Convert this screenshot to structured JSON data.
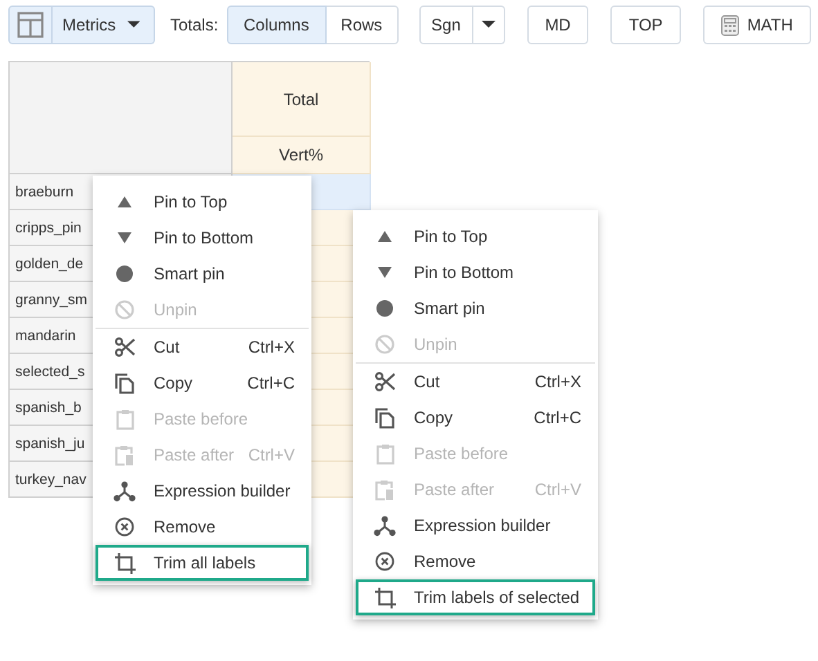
{
  "toolbar": {
    "layout_button": {
      "selected": true
    },
    "metrics": {
      "label": "Metrics",
      "selected": true
    },
    "totals_label": "Totals:",
    "totals": [
      {
        "label": "Columns",
        "selected": true
      },
      {
        "label": "Rows",
        "selected": false
      }
    ],
    "sgn": "Sgn",
    "buttons": [
      {
        "label": "MD",
        "kind": "plain"
      },
      {
        "label": "TOP",
        "kind": "plain"
      },
      {
        "label": "MATH",
        "kind": "calc"
      }
    ]
  },
  "table": {
    "column": "Total",
    "measure": "Vert%",
    "rows": [
      {
        "label": "braeburn",
        "selected": true
      },
      {
        "label": "cripps_pin",
        "selected": false
      },
      {
        "label": "golden_de",
        "selected": false
      },
      {
        "label": "granny_sm",
        "selected": false
      },
      {
        "label": "mandarin",
        "selected": false
      },
      {
        "label": "selected_s",
        "selected": false
      },
      {
        "label": "spanish_b",
        "selected": false
      },
      {
        "label": "spanish_ju",
        "selected": false
      },
      {
        "label": "turkey_nav",
        "selected": false
      }
    ]
  },
  "menus": [
    {
      "groups": [
        [
          {
            "kind": "pintop",
            "label": "Pin to Top",
            "disabled": false,
            "highlighted": false
          },
          {
            "kind": "pinbottom",
            "label": "Pin to Bottom",
            "disabled": false,
            "highlighted": false
          },
          {
            "kind": "smartpin",
            "label": "Smart pin",
            "disabled": false,
            "highlighted": false
          },
          {
            "kind": "unpin",
            "label": "Unpin",
            "disabled": true,
            "highlighted": false
          }
        ],
        [
          {
            "kind": "cut",
            "label": "Cut",
            "shortcut": "Ctrl+X",
            "disabled": false,
            "highlighted": false
          },
          {
            "kind": "copy",
            "label": "Copy",
            "shortcut": "Ctrl+C",
            "disabled": false,
            "highlighted": false
          },
          {
            "kind": "pastebefore",
            "label": "Paste before",
            "disabled": true,
            "highlighted": false
          },
          {
            "kind": "pasteafter",
            "label": "Paste after",
            "shortcut": "Ctrl+V",
            "disabled": true,
            "highlighted": false
          },
          {
            "kind": "expression",
            "label": "Expression builder",
            "disabled": false,
            "highlighted": false
          },
          {
            "kind": "remove",
            "label": "Remove",
            "disabled": false,
            "highlighted": false
          },
          {
            "kind": "trim",
            "label": "Trim all labels",
            "disabled": false,
            "highlighted": true
          }
        ]
      ]
    },
    {
      "groups": [
        [
          {
            "kind": "pintop",
            "label": "Pin to Top",
            "disabled": false,
            "highlighted": false
          },
          {
            "kind": "pinbottom",
            "label": "Pin to Bottom",
            "disabled": false,
            "highlighted": false
          },
          {
            "kind": "smartpin",
            "label": "Smart pin",
            "disabled": false,
            "highlighted": false
          },
          {
            "kind": "unpin",
            "label": "Unpin",
            "disabled": true,
            "highlighted": false
          }
        ],
        [
          {
            "kind": "cut",
            "label": "Cut",
            "shortcut": "Ctrl+X",
            "disabled": false,
            "highlighted": false
          },
          {
            "kind": "copy",
            "label": "Copy",
            "shortcut": "Ctrl+C",
            "disabled": false,
            "highlighted": false
          },
          {
            "kind": "pastebefore",
            "label": "Paste before",
            "disabled": true,
            "highlighted": false
          },
          {
            "kind": "pasteafter",
            "label": "Paste after",
            "shortcut": "Ctrl+V",
            "disabled": true,
            "highlighted": false
          },
          {
            "kind": "expression",
            "label": "Expression builder",
            "disabled": false,
            "highlighted": false
          },
          {
            "kind": "remove",
            "label": "Remove",
            "disabled": false,
            "highlighted": false
          },
          {
            "kind": "trim",
            "label": "Trim labels of selected",
            "disabled": false,
            "highlighted": true
          }
        ]
      ]
    }
  ]
}
